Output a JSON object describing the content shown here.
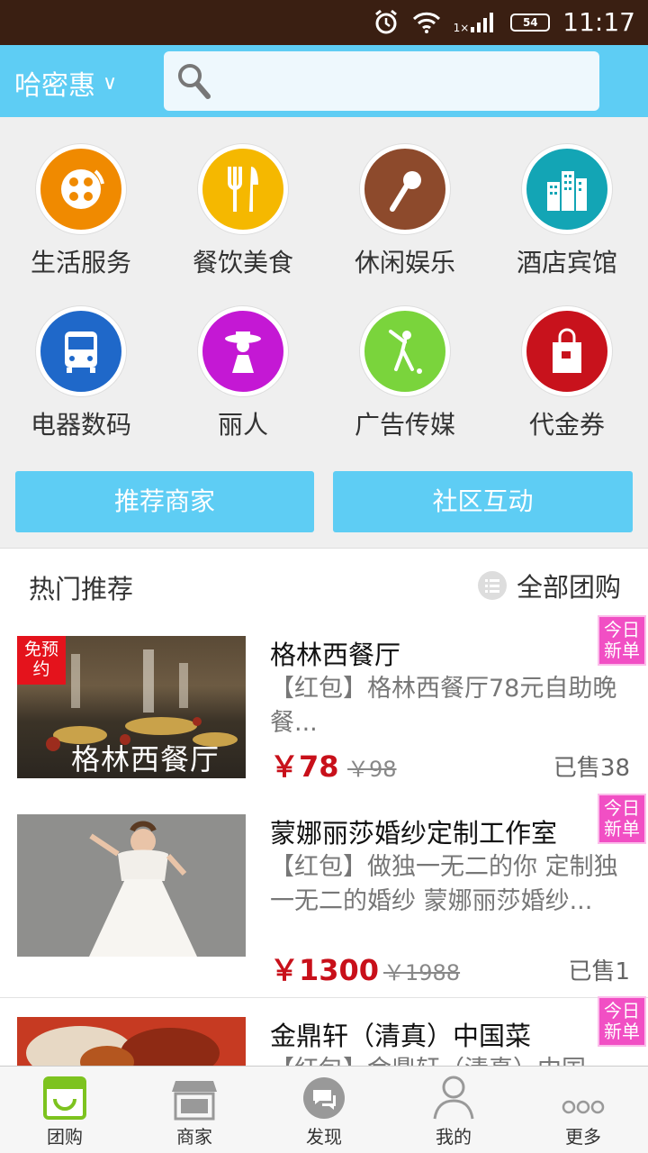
{
  "status_bar": {
    "time": "11:17",
    "battery": "54",
    "signal": "1×"
  },
  "header": {
    "city": "哈密惠",
    "city_chevron": "∨",
    "search_placeholder": ""
  },
  "categories": [
    {
      "label": "生活服务",
      "color": "#f08a00",
      "icon": "film-reel-icon"
    },
    {
      "label": "餐饮美食",
      "color": "#f5b800",
      "icon": "fork-knife-icon"
    },
    {
      "label": "休闲娱乐",
      "color": "#8d4a2c",
      "icon": "microphone-icon"
    },
    {
      "label": "酒店宾馆",
      "color": "#13a5b5",
      "icon": "building-icon"
    },
    {
      "label": "电器数码",
      "color": "#1f68c9",
      "icon": "bus-icon"
    },
    {
      "label": "丽人",
      "color": "#c418d4",
      "icon": "lady-hat-icon"
    },
    {
      "label": "广告传媒",
      "color": "#7ad43c",
      "icon": "golfer-icon"
    },
    {
      "label": "代金券",
      "color": "#c8121c",
      "icon": "shopping-bag-icon"
    }
  ],
  "buttons": {
    "recommend": "推荐商家",
    "community": "社区互动"
  },
  "hot": {
    "title": "热门推荐",
    "all": "全部团购"
  },
  "deals": [
    {
      "title": "格林西餐厅",
      "desc": "【红包】格林西餐厅78元自助晚餐...",
      "price": "￥78",
      "orig": "￥98",
      "sold": "已售38",
      "badge": "今日新单",
      "free_tag": "免预约",
      "image_caption": "格林西餐厅"
    },
    {
      "title": "蒙娜丽莎婚纱定制工作室",
      "desc": "【红包】做独一无二的你 定制独一无二的婚纱 蒙娜丽莎婚纱...",
      "price": "￥1300",
      "orig": "￥1988",
      "sold": "已售1",
      "badge": "今日新单"
    },
    {
      "title": "金鼎轩（清真）中国菜",
      "desc": "【红包】金鼎轩（清真）中国",
      "badge": "今日新单"
    }
  ],
  "tabs": [
    {
      "label": "团购",
      "icon": "shopping-basket-icon",
      "active": true
    },
    {
      "label": "商家",
      "icon": "storefront-icon"
    },
    {
      "label": "发现",
      "icon": "chat-bubble-icon"
    },
    {
      "label": "我的",
      "icon": "person-icon"
    },
    {
      "label": "更多",
      "icon": "more-dots-icon"
    }
  ],
  "colors": {
    "accent": "#5ecdf4",
    "price": "#c8101a",
    "badge": "#f14fc4",
    "tab_active": "#7dc31f"
  }
}
